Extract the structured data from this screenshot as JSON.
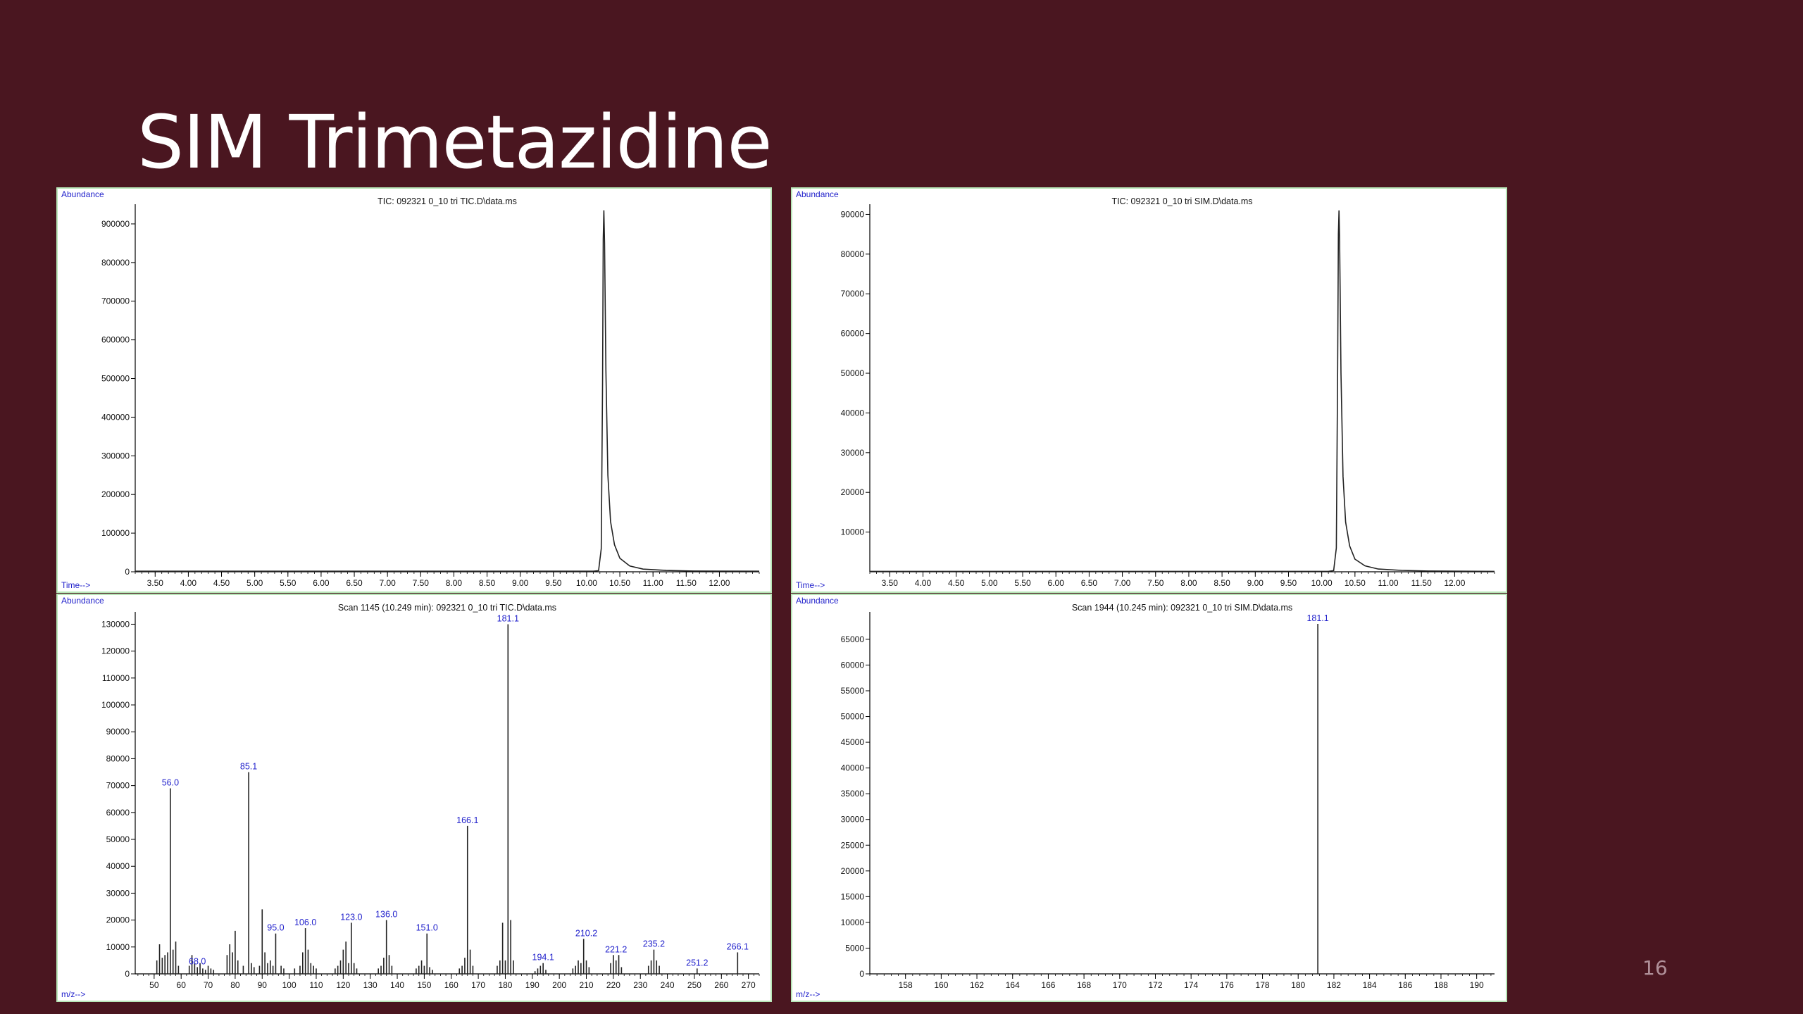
{
  "slide": {
    "title": "SIM Trimetazidine",
    "page_number": "16"
  },
  "colors": {
    "background": "#4a1620",
    "axis_label": "#2222cc",
    "peak_label": "#2222cc",
    "trace": "#222222",
    "panel_border": "#b8e6b8"
  },
  "chart_data": [
    {
      "id": "tic-scan",
      "type": "line",
      "title": "TIC: 092321 0_10 tri TIC.D\\data.ms",
      "ylabel": "Abundance",
      "xlabel": "Time-->",
      "xlim": [
        3.2,
        12.6
      ],
      "ylim": [
        0,
        940000
      ],
      "xticks": [
        3.5,
        4.0,
        4.5,
        5.0,
        5.5,
        6.0,
        6.5,
        7.0,
        7.5,
        8.0,
        8.5,
        9.0,
        9.5,
        10.0,
        10.5,
        11.0,
        11.5,
        12.0
      ],
      "xtick_labels": [
        "3.50",
        "4.00",
        "4.50",
        "5.00",
        "5.50",
        "6.00",
        "6.50",
        "7.00",
        "7.50",
        "8.00",
        "8.50",
        "9.00",
        "9.50",
        "10.00",
        "10.50",
        "11.00",
        "11.50",
        "12.00"
      ],
      "yticks": [
        0,
        100000,
        200000,
        300000,
        400000,
        500000,
        600000,
        700000,
        800000,
        900000
      ],
      "ytick_labels": [
        "0",
        "100000",
        "200000",
        "300000",
        "400000",
        "500000",
        "600000",
        "700000",
        "800000",
        "900000"
      ],
      "series": [
        {
          "x": [
            3.2,
            10.1,
            10.18,
            10.22,
            10.24,
            10.25,
            10.26,
            10.27,
            10.29,
            10.32,
            10.36,
            10.42,
            10.5,
            10.65,
            10.85,
            11.2,
            11.6,
            12.6
          ],
          "y": [
            1500,
            1500,
            3000,
            60000,
            500000,
            860000,
            935000,
            850000,
            520000,
            250000,
            130000,
            70000,
            35000,
            15000,
            7000,
            3500,
            2000,
            1500
          ]
        }
      ]
    },
    {
      "id": "tic-sim",
      "type": "line",
      "title": "TIC: 092321 0_10 tri SIM.D\\data.ms",
      "ylabel": "Abundance",
      "xlabel": "Time-->",
      "xlim": [
        3.2,
        12.6
      ],
      "ylim": [
        0,
        91500
      ],
      "xticks": [
        3.5,
        4.0,
        4.5,
        5.0,
        5.5,
        6.0,
        6.5,
        7.0,
        7.5,
        8.0,
        8.5,
        9.0,
        9.5,
        10.0,
        10.5,
        11.0,
        11.5,
        12.0
      ],
      "xtick_labels": [
        "3.50",
        "4.00",
        "4.50",
        "5.00",
        "5.50",
        "6.00",
        "6.50",
        "7.00",
        "7.50",
        "8.00",
        "8.50",
        "9.00",
        "9.50",
        "10.00",
        "10.50",
        "11.00",
        "11.50",
        "12.00"
      ],
      "yticks": [
        10000,
        20000,
        30000,
        40000,
        50000,
        60000,
        70000,
        80000,
        90000
      ],
      "ytick_labels": [
        "10000",
        "20000",
        "30000",
        "40000",
        "50000",
        "60000",
        "70000",
        "80000",
        "90000"
      ],
      "series": [
        {
          "x": [
            3.2,
            10.1,
            10.18,
            10.22,
            10.24,
            10.25,
            10.26,
            10.27,
            10.29,
            10.32,
            10.36,
            10.42,
            10.5,
            10.65,
            10.85,
            11.2,
            11.6,
            12.6
          ],
          "y": [
            100,
            100,
            300,
            6000,
            52000,
            85000,
            91000,
            83000,
            50000,
            24000,
            12500,
            6500,
            3200,
            1500,
            700,
            350,
            200,
            100
          ]
        }
      ]
    },
    {
      "id": "ms-scan",
      "type": "bar",
      "title": "Scan 1145 (10.249 min): 092321 0_10 tri TIC.D\\data.ms",
      "ylabel": "Abundance",
      "xlabel": "m/z-->",
      "xlim": [
        43,
        274
      ],
      "ylim": [
        0,
        133000
      ],
      "xticks": [
        50,
        60,
        70,
        80,
        90,
        100,
        110,
        120,
        130,
        140,
        150,
        160,
        170,
        180,
        190,
        200,
        210,
        220,
        230,
        240,
        250,
        260,
        270
      ],
      "xtick_labels": [
        "50",
        "60",
        "70",
        "80",
        "90",
        "100",
        "110",
        "120",
        "130",
        "140",
        "150",
        "160",
        "170",
        "180",
        "190",
        "200",
        "210",
        "220",
        "230",
        "240",
        "250",
        "260",
        "270"
      ],
      "yticks": [
        0,
        10000,
        20000,
        30000,
        40000,
        50000,
        60000,
        70000,
        80000,
        90000,
        100000,
        110000,
        120000,
        130000
      ],
      "ytick_labels": [
        "0",
        "10000",
        "20000",
        "30000",
        "40000",
        "50000",
        "60000",
        "70000",
        "80000",
        "90000",
        "100000",
        "110000",
        "120000",
        "130000"
      ],
      "series": [
        {
          "x": [
            51,
            52,
            53,
            54,
            55,
            56,
            57,
            58,
            59,
            63,
            64,
            65,
            66,
            67,
            68,
            69,
            70,
            71,
            72,
            77,
            78,
            79,
            80,
            81,
            83,
            85,
            86,
            87,
            89,
            90,
            91,
            92,
            93,
            94,
            95,
            97,
            98,
            102,
            104,
            105,
            106,
            107,
            108,
            109,
            110,
            117,
            118,
            119,
            120,
            121,
            122,
            123,
            124,
            125,
            133,
            134,
            135,
            136,
            137,
            138,
            147,
            148,
            149,
            150,
            151,
            152,
            153,
            163,
            164,
            165,
            166,
            167,
            168,
            177,
            178,
            179,
            180,
            181,
            182,
            183,
            191,
            192,
            193,
            194,
            195,
            205,
            206,
            207,
            208,
            209,
            210,
            211,
            219,
            220,
            221,
            222,
            223,
            233,
            234,
            235,
            236,
            237,
            251,
            266
          ],
          "y": [
            5000,
            11000,
            6000,
            7000,
            8000,
            69000,
            9000,
            12000,
            3000,
            3000,
            7000,
            4000,
            2500,
            4000,
            2000,
            1500,
            3000,
            2000,
            1500,
            7000,
            11000,
            8000,
            16000,
            5000,
            3000,
            75000,
            4000,
            2500,
            3000,
            24000,
            8000,
            4000,
            5000,
            3000,
            15000,
            3000,
            2000,
            2000,
            3000,
            8000,
            17000,
            9000,
            4000,
            3000,
            2000,
            2000,
            3000,
            5000,
            9000,
            12000,
            4000,
            19000,
            4000,
            2000,
            2000,
            3000,
            6000,
            20000,
            7000,
            3000,
            2000,
            3000,
            5000,
            3000,
            15000,
            2500,
            1500,
            2000,
            3000,
            6000,
            55000,
            9000,
            3000,
            3000,
            5000,
            19000,
            5000,
            130000,
            20000,
            5000,
            1000,
            2000,
            3000,
            4000,
            1500,
            2000,
            3000,
            5000,
            4000,
            13000,
            5000,
            2500,
            4000,
            7000,
            5000,
            7000,
            2500,
            3000,
            5000,
            9000,
            5000,
            3000,
            2000,
            8000
          ],
          "labels": [
            {
              "x": 56,
              "y": 69000,
              "text": "56.0"
            },
            {
              "x": 85,
              "y": 75000,
              "text": "85.1"
            },
            {
              "x": 95,
              "y": 15000,
              "text": "95.0"
            },
            {
              "x": 106,
              "y": 17000,
              "text": "106.0"
            },
            {
              "x": 123,
              "y": 19000,
              "text": "123.0"
            },
            {
              "x": 136,
              "y": 20000,
              "text": "136.0"
            },
            {
              "x": 151,
              "y": 15000,
              "text": "151.0"
            },
            {
              "x": 166,
              "y": 55000,
              "text": "166.1"
            },
            {
              "x": 181,
              "y": 130000,
              "text": "181.1"
            },
            {
              "x": 194,
              "y": 4000,
              "text": "194.1"
            },
            {
              "x": 210,
              "y": 13000,
              "text": "210.2"
            },
            {
              "x": 221,
              "y": 7000,
              "text": "221.2"
            },
            {
              "x": 235,
              "y": 9000,
              "text": "235.2"
            },
            {
              "x": 251,
              "y": 2000,
              "text": "251.2"
            },
            {
              "x": 266,
              "y": 8000,
              "text": "266.1"
            },
            {
              "x": 66,
              "y": 2500,
              "text": "68.0"
            }
          ]
        }
      ]
    },
    {
      "id": "ms-sim",
      "type": "bar",
      "title": "Scan 1944 (10.245 min): 092321 0_10 tri SIM.D\\data.ms",
      "ylabel": "Abundance",
      "xlabel": "m/z-->",
      "xlim": [
        156,
        191
      ],
      "ylim": [
        0,
        69500
      ],
      "xticks": [
        158,
        160,
        162,
        164,
        166,
        168,
        170,
        172,
        174,
        176,
        178,
        180,
        182,
        184,
        186,
        188,
        190
      ],
      "xtick_labels": [
        "158",
        "160",
        "162",
        "164",
        "166",
        "168",
        "170",
        "172",
        "174",
        "176",
        "178",
        "180",
        "182",
        "184",
        "186",
        "188",
        "190"
      ],
      "yticks": [
        0,
        5000,
        10000,
        15000,
        20000,
        25000,
        30000,
        35000,
        40000,
        45000,
        50000,
        55000,
        60000,
        65000
      ],
      "ytick_labels": [
        "0",
        "5000",
        "10000",
        "15000",
        "20000",
        "25000",
        "30000",
        "35000",
        "40000",
        "45000",
        "50000",
        "55000",
        "60000",
        "65000"
      ],
      "series": [
        {
          "x": [
            181.1
          ],
          "y": [
            68000
          ],
          "labels": [
            {
              "x": 181.1,
              "y": 68000,
              "text": "181.1"
            }
          ]
        }
      ]
    }
  ]
}
